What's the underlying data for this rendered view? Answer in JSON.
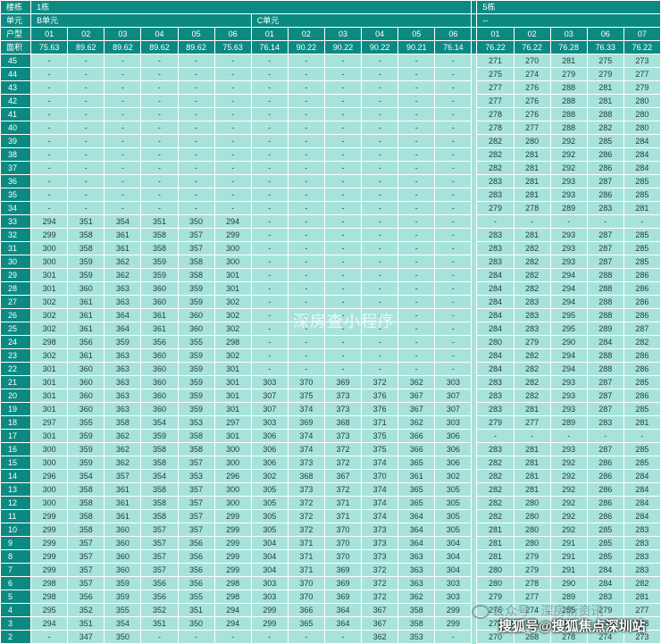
{
  "header": {
    "building_label": "楼栋",
    "unit_label": "单元",
    "type_label": "户型",
    "area_label": "面积",
    "left_building": "1栋",
    "unit_b": "B单元",
    "unit_c": "C单元",
    "right_building": "5栋",
    "right_unit": "--",
    "left_types": [
      "01",
      "02",
      "03",
      "04",
      "05",
      "06",
      "01",
      "02",
      "03",
      "04",
      "05",
      "06"
    ],
    "left_areas": [
      "75.63",
      "89.62",
      "89.62",
      "89.62",
      "89.62",
      "75.63",
      "76.14",
      "90.22",
      "90.22",
      "90.22",
      "90.21",
      "76.14"
    ],
    "right_types": [
      "01",
      "02",
      "03",
      "06",
      "07"
    ],
    "right_areas": [
      "76.22",
      "76.22",
      "76.28",
      "76.33",
      "76.22"
    ]
  },
  "rows": [
    {
      "floor": "45",
      "b": [
        "-",
        "-",
        "-",
        "-",
        "-",
        "-"
      ],
      "c": [
        "-",
        "-",
        "-",
        "-",
        "-",
        "-"
      ],
      "r": [
        "271",
        "270",
        "281",
        "275",
        "273"
      ]
    },
    {
      "floor": "44",
      "b": [
        "-",
        "-",
        "-",
        "-",
        "-",
        "-"
      ],
      "c": [
        "-",
        "-",
        "-",
        "-",
        "-",
        "-"
      ],
      "r": [
        "275",
        "274",
        "279",
        "279",
        "277"
      ]
    },
    {
      "floor": "43",
      "b": [
        "-",
        "-",
        "-",
        "-",
        "-",
        "-"
      ],
      "c": [
        "-",
        "-",
        "-",
        "-",
        "-",
        "-"
      ],
      "r": [
        "277",
        "276",
        "288",
        "281",
        "279"
      ]
    },
    {
      "floor": "42",
      "b": [
        "-",
        "-",
        "-",
        "-",
        "-",
        "-"
      ],
      "c": [
        "-",
        "-",
        "-",
        "-",
        "-",
        "-"
      ],
      "r": [
        "277",
        "276",
        "288",
        "281",
        "280"
      ]
    },
    {
      "floor": "41",
      "b": [
        "-",
        "-",
        "-",
        "-",
        "-",
        "-"
      ],
      "c": [
        "-",
        "-",
        "-",
        "-",
        "-",
        "-"
      ],
      "r": [
        "278",
        "276",
        "288",
        "288",
        "280"
      ]
    },
    {
      "floor": "40",
      "b": [
        "-",
        "-",
        "-",
        "-",
        "-",
        "-"
      ],
      "c": [
        "-",
        "-",
        "-",
        "-",
        "-",
        "-"
      ],
      "r": [
        "278",
        "277",
        "288",
        "282",
        "280"
      ]
    },
    {
      "floor": "39",
      "b": [
        "-",
        "-",
        "-",
        "-",
        "-",
        "-"
      ],
      "c": [
        "-",
        "-",
        "-",
        "-",
        "-",
        "-"
      ],
      "r": [
        "282",
        "280",
        "292",
        "285",
        "284"
      ]
    },
    {
      "floor": "38",
      "b": [
        "-",
        "-",
        "-",
        "-",
        "-",
        "-"
      ],
      "c": [
        "-",
        "-",
        "-",
        "-",
        "-",
        "-"
      ],
      "r": [
        "282",
        "281",
        "292",
        "286",
        "284"
      ]
    },
    {
      "floor": "37",
      "b": [
        "-",
        "-",
        "-",
        "-",
        "-",
        "-"
      ],
      "c": [
        "-",
        "-",
        "-",
        "-",
        "-",
        "-"
      ],
      "r": [
        "282",
        "281",
        "292",
        "286",
        "284"
      ]
    },
    {
      "floor": "36",
      "b": [
        "-",
        "-",
        "-",
        "-",
        "-",
        "-"
      ],
      "c": [
        "-",
        "-",
        "-",
        "-",
        "-",
        "-"
      ],
      "r": [
        "283",
        "281",
        "293",
        "287",
        "285"
      ]
    },
    {
      "floor": "35",
      "b": [
        "-",
        "-",
        "-",
        "-",
        "-",
        "-"
      ],
      "c": [
        "-",
        "-",
        "-",
        "-",
        "-",
        "-"
      ],
      "r": [
        "283",
        "281",
        "293",
        "286",
        "285"
      ]
    },
    {
      "floor": "34",
      "b": [
        "-",
        "-",
        "-",
        "-",
        "-",
        "-"
      ],
      "c": [
        "-",
        "-",
        "-",
        "-",
        "-",
        "-"
      ],
      "r": [
        "279",
        "278",
        "289",
        "283",
        "281"
      ]
    },
    {
      "floor": "33",
      "b": [
        "294",
        "351",
        "354",
        "351",
        "350",
        "294"
      ],
      "c": [
        "-",
        "-",
        "-",
        "-",
        "-",
        "-"
      ],
      "r": [
        "-",
        "-",
        "-",
        "-",
        "-"
      ]
    },
    {
      "floor": "32",
      "b": [
        "299",
        "358",
        "361",
        "358",
        "357",
        "299"
      ],
      "c": [
        "-",
        "-",
        "-",
        "-",
        "-",
        "-"
      ],
      "r": [
        "283",
        "281",
        "293",
        "287",
        "285"
      ]
    },
    {
      "floor": "31",
      "b": [
        "300",
        "358",
        "361",
        "358",
        "357",
        "300"
      ],
      "c": [
        "-",
        "-",
        "-",
        "-",
        "-",
        "-"
      ],
      "r": [
        "283",
        "282",
        "293",
        "287",
        "285"
      ]
    },
    {
      "floor": "30",
      "b": [
        "300",
        "359",
        "362",
        "359",
        "358",
        "300"
      ],
      "c": [
        "-",
        "-",
        "-",
        "-",
        "-",
        "-"
      ],
      "r": [
        "283",
        "282",
        "293",
        "287",
        "285"
      ]
    },
    {
      "floor": "29",
      "b": [
        "301",
        "359",
        "362",
        "359",
        "358",
        "301"
      ],
      "c": [
        "-",
        "-",
        "-",
        "-",
        "-",
        "-"
      ],
      "r": [
        "284",
        "282",
        "294",
        "288",
        "286"
      ]
    },
    {
      "floor": "28",
      "b": [
        "301",
        "360",
        "363",
        "360",
        "359",
        "301"
      ],
      "c": [
        "-",
        "-",
        "-",
        "-",
        "-",
        "-"
      ],
      "r": [
        "284",
        "282",
        "294",
        "288",
        "286"
      ]
    },
    {
      "floor": "27",
      "b": [
        "302",
        "361",
        "363",
        "360",
        "359",
        "302"
      ],
      "c": [
        "-",
        "-",
        "-",
        "-",
        "-",
        "-"
      ],
      "r": [
        "284",
        "283",
        "294",
        "288",
        "286"
      ]
    },
    {
      "floor": "26",
      "b": [
        "302",
        "361",
        "364",
        "361",
        "360",
        "302"
      ],
      "c": [
        "-",
        "-",
        "-",
        "-",
        "-",
        "-"
      ],
      "r": [
        "284",
        "283",
        "295",
        "288",
        "286"
      ]
    },
    {
      "floor": "25",
      "b": [
        "302",
        "361",
        "364",
        "361",
        "360",
        "302"
      ],
      "c": [
        "-",
        "-",
        "-",
        "-",
        "-",
        "-"
      ],
      "r": [
        "284",
        "283",
        "295",
        "289",
        "287"
      ]
    },
    {
      "floor": "24",
      "b": [
        "298",
        "356",
        "359",
        "356",
        "355",
        "298"
      ],
      "c": [
        "-",
        "-",
        "-",
        "-",
        "-",
        "-"
      ],
      "r": [
        "280",
        "279",
        "290",
        "284",
        "282"
      ]
    },
    {
      "floor": "23",
      "b": [
        "302",
        "361",
        "363",
        "360",
        "359",
        "302"
      ],
      "c": [
        "-",
        "-",
        "-",
        "-",
        "-",
        "-"
      ],
      "r": [
        "284",
        "282",
        "294",
        "288",
        "286"
      ]
    },
    {
      "floor": "22",
      "b": [
        "301",
        "360",
        "363",
        "360",
        "359",
        "301"
      ],
      "c": [
        "-",
        "-",
        "-",
        "-",
        "-",
        "-"
      ],
      "r": [
        "284",
        "282",
        "294",
        "288",
        "286"
      ]
    },
    {
      "floor": "21",
      "b": [
        "301",
        "360",
        "363",
        "360",
        "359",
        "301"
      ],
      "c": [
        "303",
        "370",
        "369",
        "372",
        "362",
        "303"
      ],
      "r": [
        "283",
        "282",
        "293",
        "287",
        "285"
      ]
    },
    {
      "floor": "20",
      "b": [
        "301",
        "360",
        "363",
        "360",
        "359",
        "301"
      ],
      "c": [
        "307",
        "375",
        "373",
        "376",
        "367",
        "307"
      ],
      "r": [
        "283",
        "282",
        "293",
        "287",
        "286"
      ]
    },
    {
      "floor": "19",
      "b": [
        "301",
        "360",
        "363",
        "360",
        "359",
        "301"
      ],
      "c": [
        "307",
        "374",
        "373",
        "376",
        "367",
        "307"
      ],
      "r": [
        "283",
        "281",
        "293",
        "287",
        "285"
      ]
    },
    {
      "floor": "18",
      "b": [
        "297",
        "355",
        "358",
        "354",
        "353",
        "297"
      ],
      "c": [
        "303",
        "369",
        "368",
        "371",
        "362",
        "303"
      ],
      "r": [
        "279",
        "277",
        "289",
        "283",
        "281"
      ]
    },
    {
      "floor": "17",
      "b": [
        "301",
        "359",
        "362",
        "359",
        "358",
        "301"
      ],
      "c": [
        "306",
        "374",
        "373",
        "375",
        "366",
        "306"
      ],
      "r": [
        "-",
        "-",
        "-",
        "-",
        "-"
      ]
    },
    {
      "floor": "16",
      "b": [
        "300",
        "359",
        "362",
        "358",
        "358",
        "300"
      ],
      "c": [
        "306",
        "374",
        "372",
        "375",
        "366",
        "306"
      ],
      "r": [
        "283",
        "281",
        "293",
        "287",
        "285"
      ]
    },
    {
      "floor": "15",
      "b": [
        "300",
        "359",
        "362",
        "358",
        "357",
        "300"
      ],
      "c": [
        "306",
        "373",
        "372",
        "374",
        "365",
        "306"
      ],
      "r": [
        "282",
        "281",
        "292",
        "286",
        "285"
      ]
    },
    {
      "floor": "14",
      "b": [
        "296",
        "354",
        "357",
        "354",
        "353",
        "296"
      ],
      "c": [
        "302",
        "368",
        "367",
        "370",
        "361",
        "302"
      ],
      "r": [
        "282",
        "281",
        "292",
        "286",
        "284"
      ]
    },
    {
      "floor": "13",
      "b": [
        "300",
        "358",
        "361",
        "358",
        "357",
        "300"
      ],
      "c": [
        "305",
        "373",
        "372",
        "374",
        "365",
        "305"
      ],
      "r": [
        "282",
        "281",
        "292",
        "286",
        "284"
      ]
    },
    {
      "floor": "12",
      "b": [
        "300",
        "358",
        "361",
        "358",
        "357",
        "300"
      ],
      "c": [
        "305",
        "372",
        "371",
        "374",
        "365",
        "305"
      ],
      "r": [
        "282",
        "280",
        "292",
        "286",
        "284"
      ]
    },
    {
      "floor": "11",
      "b": [
        "299",
        "358",
        "361",
        "358",
        "357",
        "299"
      ],
      "c": [
        "305",
        "372",
        "371",
        "374",
        "364",
        "305"
      ],
      "r": [
        "282",
        "280",
        "292",
        "286",
        "284"
      ]
    },
    {
      "floor": "10",
      "b": [
        "299",
        "358",
        "360",
        "357",
        "357",
        "299"
      ],
      "c": [
        "305",
        "372",
        "370",
        "373",
        "364",
        "305"
      ],
      "r": [
        "281",
        "280",
        "292",
        "285",
        "283"
      ]
    },
    {
      "floor": "9",
      "b": [
        "299",
        "357",
        "360",
        "357",
        "356",
        "299"
      ],
      "c": [
        "304",
        "371",
        "370",
        "373",
        "364",
        "304"
      ],
      "r": [
        "281",
        "280",
        "291",
        "285",
        "283"
      ]
    },
    {
      "floor": "8",
      "b": [
        "299",
        "357",
        "360",
        "357",
        "356",
        "299"
      ],
      "c": [
        "304",
        "371",
        "370",
        "373",
        "363",
        "304"
      ],
      "r": [
        "281",
        "279",
        "291",
        "285",
        "283"
      ]
    },
    {
      "floor": "7",
      "b": [
        "299",
        "357",
        "360",
        "357",
        "356",
        "299"
      ],
      "c": [
        "304",
        "371",
        "369",
        "372",
        "363",
        "304"
      ],
      "r": [
        "280",
        "279",
        "291",
        "284",
        "283"
      ]
    },
    {
      "floor": "6",
      "b": [
        "298",
        "357",
        "359",
        "356",
        "356",
        "298"
      ],
      "c": [
        "303",
        "370",
        "369",
        "372",
        "363",
        "303"
      ],
      "r": [
        "280",
        "278",
        "290",
        "284",
        "282"
      ]
    },
    {
      "floor": "5",
      "b": [
        "298",
        "356",
        "359",
        "356",
        "355",
        "298"
      ],
      "c": [
        "303",
        "370",
        "369",
        "372",
        "362",
        "303"
      ],
      "r": [
        "279",
        "277",
        "289",
        "283",
        "281"
      ]
    },
    {
      "floor": "4",
      "b": [
        "295",
        "352",
        "355",
        "352",
        "351",
        "294"
      ],
      "c": [
        "299",
        "366",
        "364",
        "367",
        "358",
        "299"
      ],
      "r": [
        "276",
        "274",
        "285",
        "279",
        "277"
      ]
    },
    {
      "floor": "3",
      "b": [
        "294",
        "351",
        "354",
        "351",
        "350",
        "294"
      ],
      "c": [
        "299",
        "365",
        "364",
        "367",
        "358",
        "299"
      ],
      "r": [
        "275",
        "274",
        "285",
        "279",
        "278"
      ]
    },
    {
      "floor": "2",
      "b": [
        "-",
        "347",
        "350",
        "-",
        "-",
        "-"
      ],
      "c": [
        "-",
        "-",
        "-",
        "362",
        "353",
        "-"
      ],
      "r": [
        "270",
        "268",
        "278",
        "274",
        "273"
      ]
    }
  ],
  "watermarks": {
    "center": "深房查小程序",
    "wechat": "公众号 · 深房新资讯",
    "sohu": "搜狐号@搜狐焦点深圳站"
  }
}
